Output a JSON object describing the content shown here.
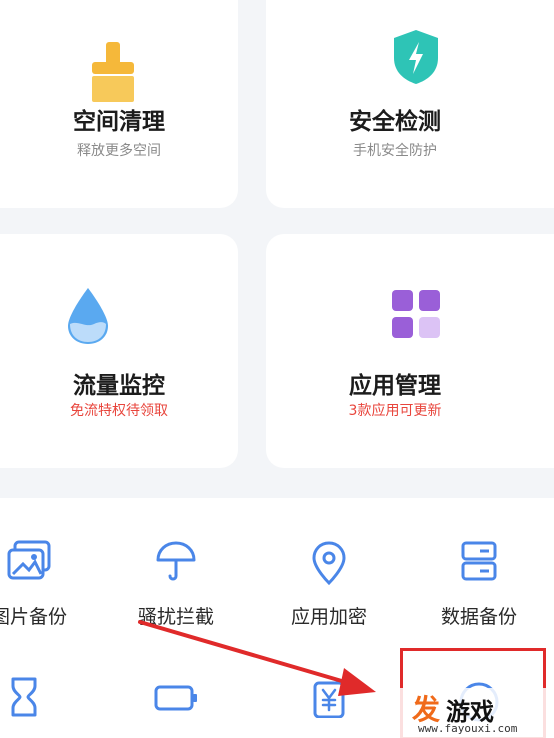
{
  "cards": [
    {
      "title": "空间清理",
      "subtitle": "释放更多空间",
      "icon": "broom-icon",
      "icon_color": "#f5b83a"
    },
    {
      "title": "安全检测",
      "subtitle": "手机安全防护",
      "icon": "shield-bolt-icon",
      "icon_color": "#2ec4b6"
    },
    {
      "title": "流量监控",
      "subtitle": "免流特权待领取",
      "subtitle_color": "#e8453c",
      "icon": "water-drop-icon",
      "icon_color": "#5aa9f0"
    },
    {
      "title": "应用管理",
      "subtitle": "3款应用可更新",
      "subtitle_color": "#e8453c",
      "icon": "app-grid-icon",
      "icon_color": "#9a5fd8"
    }
  ],
  "tools": [
    {
      "label": "图片备份",
      "icon": "photo-icon"
    },
    {
      "label": "骚扰拦截",
      "icon": "umbrella-icon"
    },
    {
      "label": "应用加密",
      "icon": "lock-pin-icon"
    },
    {
      "label": "数据备份",
      "icon": "storage-icon"
    },
    {
      "label": "",
      "icon": "hourglass-icon"
    },
    {
      "label": "",
      "icon": "battery-icon"
    },
    {
      "label": "",
      "icon": "yuan-icon"
    },
    {
      "label": "",
      "icon": "circle-icon"
    }
  ],
  "watermark": {
    "mark": "发",
    "text": "游戏",
    "url": "www.fayouxi.com"
  },
  "colors": {
    "accent": "#4a86e8",
    "annotation": "#e02a2a",
    "background": "#f3f5f8"
  }
}
